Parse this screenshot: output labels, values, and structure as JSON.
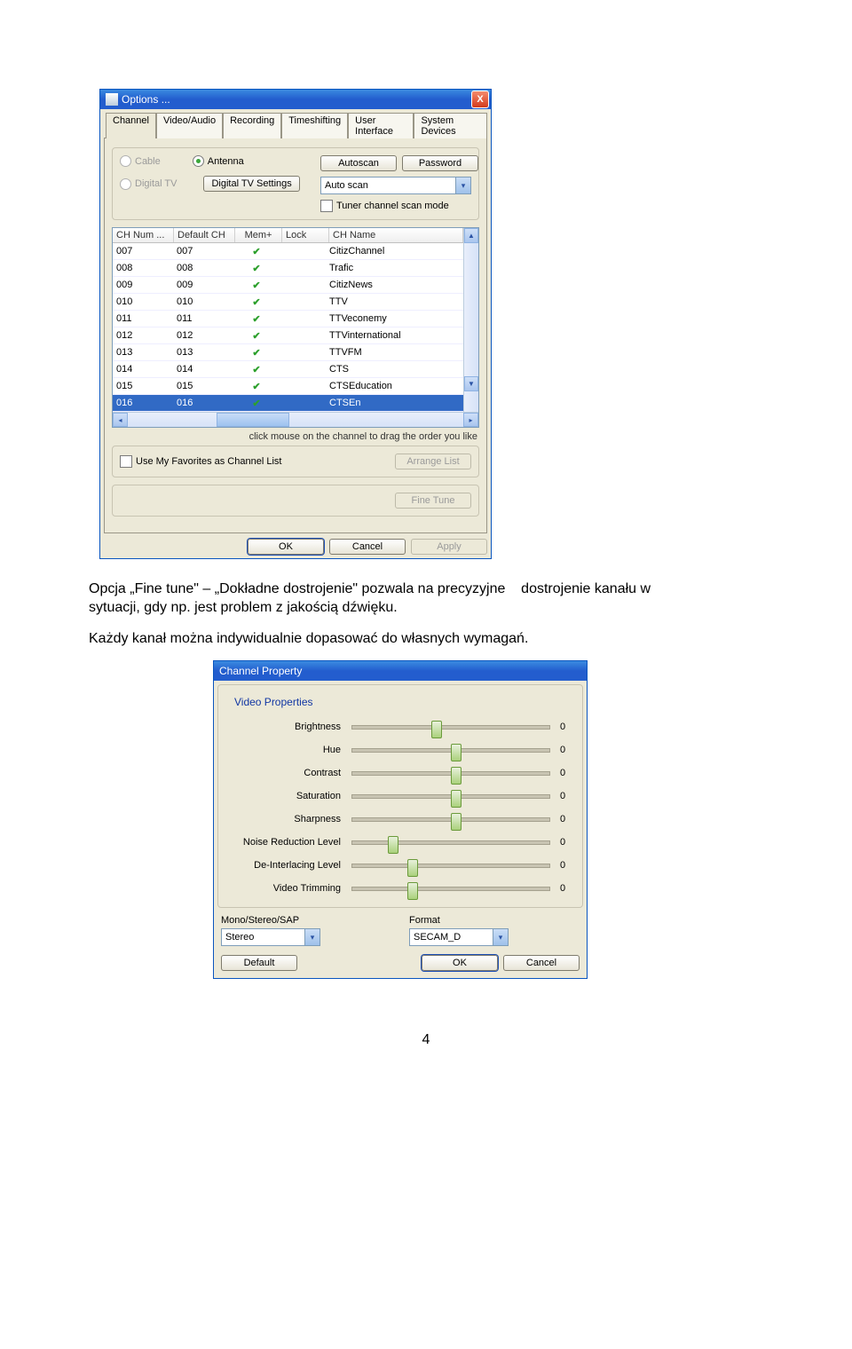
{
  "options_dialog": {
    "title": "Options ...",
    "close": "X",
    "tabs": [
      "Channel",
      "Video/Audio",
      "Recording",
      "Timeshifting",
      "User Interface",
      "System Devices"
    ],
    "active_tab": 0,
    "source": {
      "cable": "Cable",
      "antenna": "Antenna",
      "digital_tv": "Digital TV",
      "digital_tv_settings": "Digital TV Settings"
    },
    "buttons": {
      "autoscan": "Autoscan",
      "password": "Password",
      "arrange": "Arrange List",
      "finetune": "Fine Tune",
      "ok": "OK",
      "cancel": "Cancel",
      "apply": "Apply"
    },
    "scan_mode_select": "Auto scan",
    "tuner_mode_chk": "Tuner channel scan mode",
    "headers": [
      "CH Num ...",
      "Default CH",
      "Mem+",
      "Lock",
      "CH Name"
    ],
    "rows": [
      {
        "num": "007",
        "def": "007",
        "mem": true,
        "lock": "",
        "name": "CitizChannel"
      },
      {
        "num": "008",
        "def": "008",
        "mem": true,
        "lock": "",
        "name": "Trafic"
      },
      {
        "num": "009",
        "def": "009",
        "mem": true,
        "lock": "",
        "name": "CitizNews"
      },
      {
        "num": "010",
        "def": "010",
        "mem": true,
        "lock": "",
        "name": "TTV"
      },
      {
        "num": "011",
        "def": "011",
        "mem": true,
        "lock": "",
        "name": "TTVeconemy"
      },
      {
        "num": "012",
        "def": "012",
        "mem": true,
        "lock": "",
        "name": "TTVinternational"
      },
      {
        "num": "013",
        "def": "013",
        "mem": true,
        "lock": "",
        "name": "TTVFM"
      },
      {
        "num": "014",
        "def": "014",
        "mem": true,
        "lock": "",
        "name": "CTS"
      },
      {
        "num": "015",
        "def": "015",
        "mem": true,
        "lock": "",
        "name": "CTSEducation"
      },
      {
        "num": "016",
        "def": "016",
        "mem": true,
        "lock": "",
        "name": "CTSEn",
        "selected": true
      }
    ],
    "hint": "click mouse on the channel to drag the order you like",
    "fav_chk": "Use My Favorites as Channel List"
  },
  "body_text": {
    "p1a": "Opcja „Fine tune\" – „Dokładne dostrojenie\" pozwala na precyzyjne",
    "p1b": "dostrojenie kanału w",
    "p1c": "sytuacji, gdy np. jest problem z jakością dźwięku.",
    "p2": "Każdy kanał można indywidualnie dopasować do własnych wymagań."
  },
  "property_dialog": {
    "title": "Channel Property",
    "group_title": "Video Properties",
    "sliders": [
      {
        "label": "Brightness",
        "value": "0",
        "pos": 40
      },
      {
        "label": "Hue",
        "value": "0",
        "pos": 50
      },
      {
        "label": "Contrast",
        "value": "0",
        "pos": 50
      },
      {
        "label": "Saturation",
        "value": "0",
        "pos": 50
      },
      {
        "label": "Sharpness",
        "value": "0",
        "pos": 50
      },
      {
        "label": "Noise Reduction Level",
        "value": "0",
        "pos": 18
      },
      {
        "label": "De-Interlacing Level",
        "value": "0",
        "pos": 28
      },
      {
        "label": "Video Trimming",
        "value": "0",
        "pos": 28
      }
    ],
    "mono_label": "Mono/Stereo/SAP",
    "mono_value": "Stereo",
    "format_label": "Format",
    "format_value": "SECAM_D",
    "buttons": {
      "default": "Default",
      "ok": "OK",
      "cancel": "Cancel"
    }
  },
  "page_number": "4"
}
